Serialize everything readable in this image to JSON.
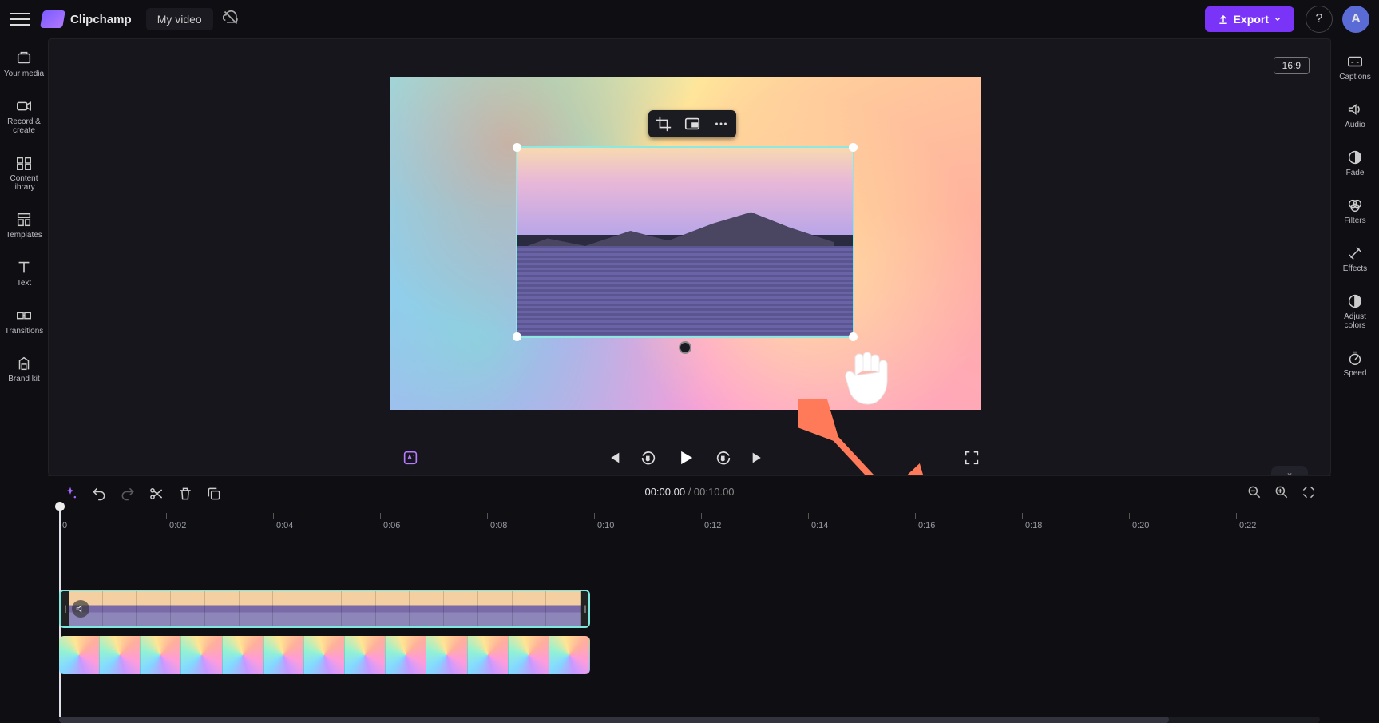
{
  "top": {
    "appname": "Clipchamp",
    "projectname": "My video",
    "export_label": "Export",
    "help_glyph": "?",
    "avatar_initial": "A"
  },
  "left_sidebar": {
    "items": [
      {
        "label": "Your media"
      },
      {
        "label": "Record & create"
      },
      {
        "label": "Content library"
      },
      {
        "label": "Templates"
      },
      {
        "label": "Text"
      },
      {
        "label": "Transitions"
      },
      {
        "label": "Brand kit"
      }
    ]
  },
  "right_sidebar": {
    "items": [
      {
        "label": "Captions"
      },
      {
        "label": "Audio"
      },
      {
        "label": "Fade"
      },
      {
        "label": "Filters"
      },
      {
        "label": "Effects"
      },
      {
        "label": "Adjust colors"
      },
      {
        "label": "Speed"
      }
    ]
  },
  "stage": {
    "aspect_label": "16:9"
  },
  "playback": {
    "current_time": "00:00.00",
    "separator": " / ",
    "duration": "00:10.00"
  },
  "ruler": {
    "labels": [
      "0",
      "0:02",
      "0:04",
      "0:06",
      "0:08",
      "0:10",
      "0:12",
      "0:14",
      "0:16",
      "0:18",
      "0:20",
      "0:22"
    ]
  }
}
